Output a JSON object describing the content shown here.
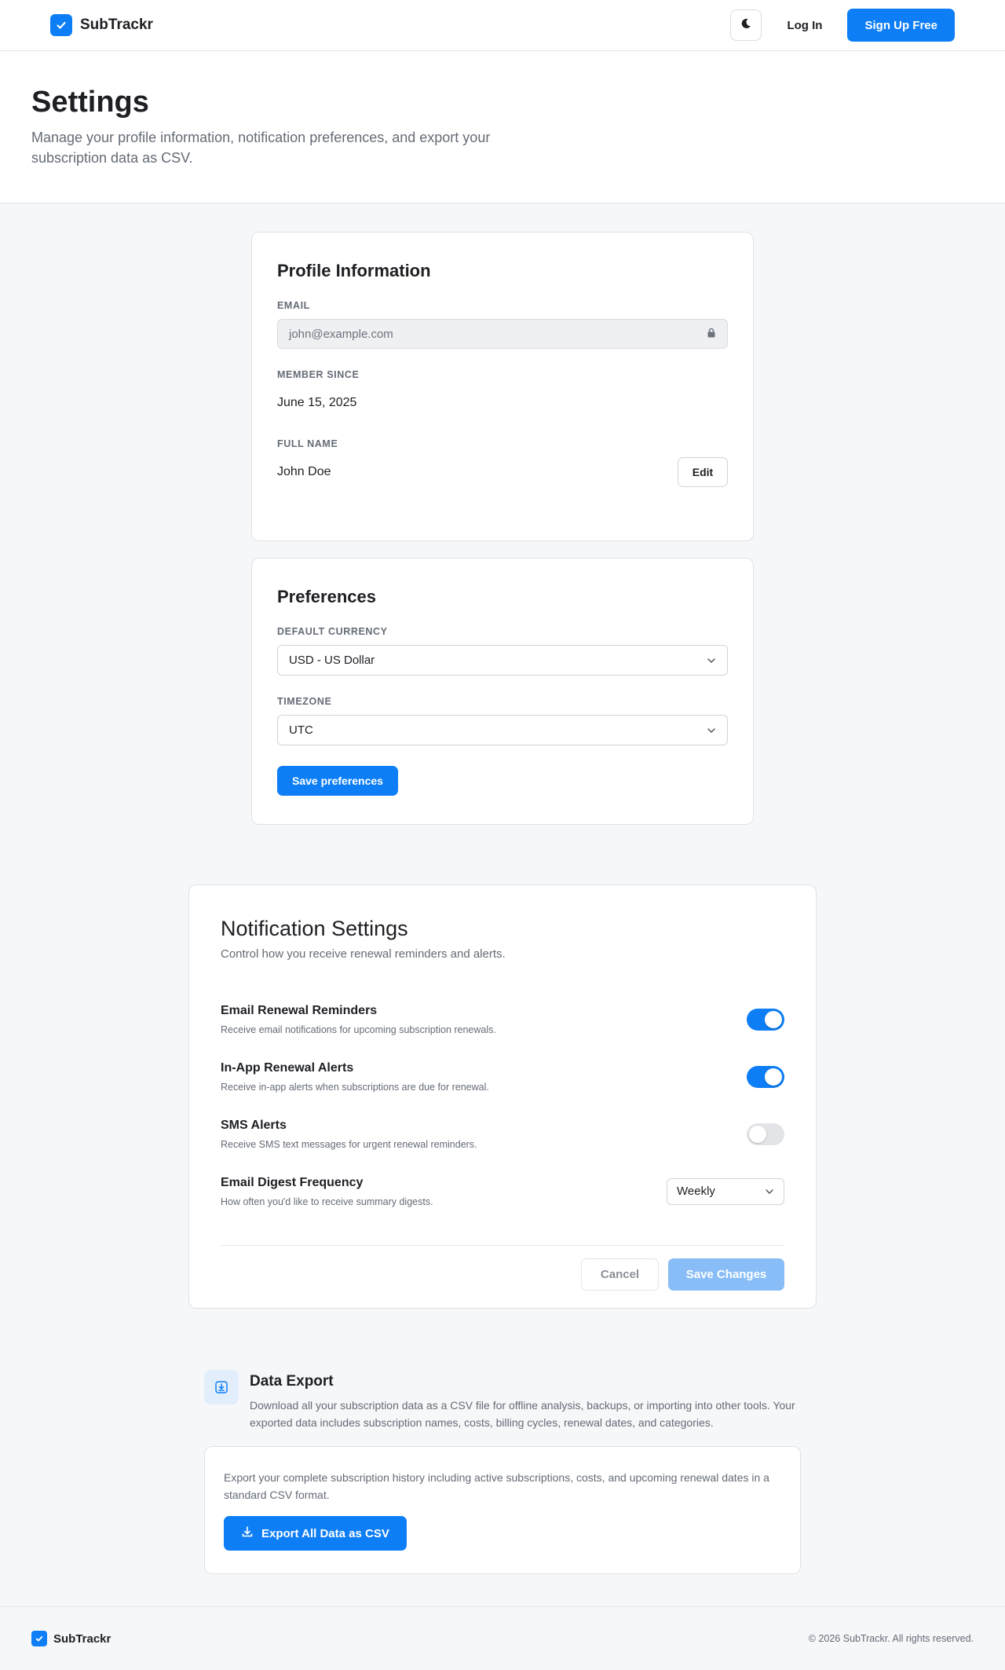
{
  "header": {
    "brand": "SubTrackr",
    "login_label": "Log In",
    "signup_label": "Sign Up Free"
  },
  "hero": {
    "title": "Settings",
    "subtitle": "Manage your profile information, notification preferences, and export your subscription data as CSV."
  },
  "profile": {
    "title": "Profile Information",
    "email_label": "EMAIL",
    "email_value": "john@example.com",
    "member_since_label": "MEMBER SINCE",
    "member_since_value": "June 15, 2025",
    "full_name_label": "FULL NAME",
    "full_name_value": "John Doe",
    "edit_label": "Edit"
  },
  "preferences": {
    "title": "Preferences",
    "currency_label": "DEFAULT CURRENCY",
    "currency_value": "USD - US Dollar",
    "timezone_label": "TIMEZONE",
    "timezone_value": "UTC",
    "save_label": "Save preferences"
  },
  "notifications": {
    "title": "Notification Settings",
    "subtitle": "Control how you receive renewal reminders and alerts.",
    "items": [
      {
        "title": "Email Renewal Reminders",
        "desc": "Receive email notifications for upcoming subscription renewals.",
        "enabled": true
      },
      {
        "title": "In-App Renewal Alerts",
        "desc": "Receive in-app alerts when subscriptions are due for renewal.",
        "enabled": true
      },
      {
        "title": "SMS Alerts",
        "desc": "Receive SMS text messages for urgent renewal reminders.",
        "enabled": false
      }
    ],
    "digest": {
      "title": "Email Digest Frequency",
      "desc": "How often you'd like to receive summary digests.",
      "value": "Weekly"
    },
    "cancel_label": "Cancel",
    "save_label": "Save Changes"
  },
  "export": {
    "title": "Data Export",
    "description": "Download all your subscription data as a CSV file for offline analysis, backups, or importing into other tools. Your exported data includes subscription names, costs, billing cycles, renewal dates, and categories.",
    "card_text": "Export your complete subscription history including active subscriptions, costs, and upcoming renewal dates in a standard CSV format.",
    "button_label": "Export All Data as CSV"
  },
  "footer": {
    "brand": "SubTrackr",
    "copyright": "© 2026 SubTrackr. All rights reserved."
  },
  "colors": {
    "accent": "#0d7ef5",
    "accent_disabled": "#88bdf7",
    "background": "#f6f7f9"
  },
  "icons": [
    "check-logo-icon",
    "moon-icon",
    "lock-icon",
    "chevron-down-icon",
    "download-icon"
  ]
}
